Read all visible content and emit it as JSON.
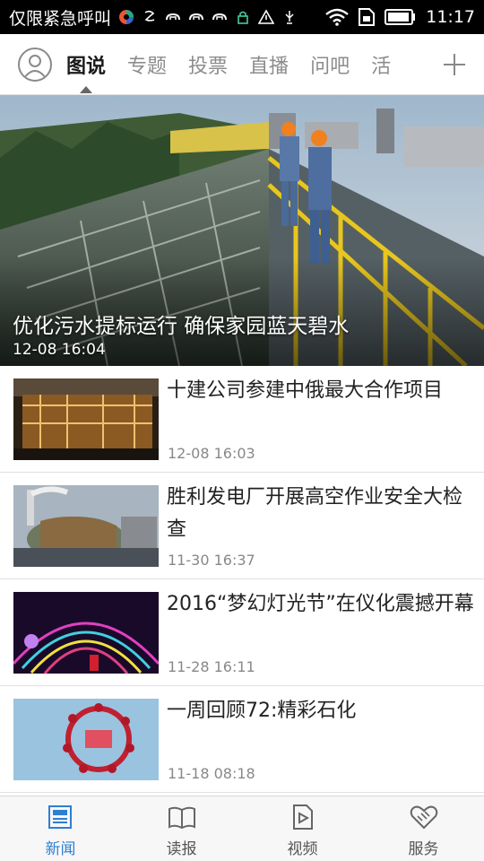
{
  "status_bar": {
    "carrier": "仅限紧急呼叫",
    "time": "11:17"
  },
  "top_nav": {
    "tabs": [
      {
        "label": "图说",
        "active": true
      },
      {
        "label": "专题",
        "active": false
      },
      {
        "label": "投票",
        "active": false
      },
      {
        "label": "直播",
        "active": false
      },
      {
        "label": "问吧",
        "active": false
      },
      {
        "label": "活",
        "active": false
      }
    ]
  },
  "hero": {
    "title": "优化污水提标运行 确保家园蓝天碧水",
    "time": "12-08 16:04"
  },
  "news": [
    {
      "title": "十建公司参建中俄最大合作项目",
      "time": "12-08 16:03"
    },
    {
      "title": "胜利发电厂开展高空作业安全大检查",
      "time": "11-30 16:37"
    },
    {
      "title": "2016“梦幻灯光节”在仪化震撼开幕",
      "time": "11-28 16:11"
    },
    {
      "title": "一周回顾72:精彩石化",
      "time": "11-18 08:18"
    }
  ],
  "bottom_nav": {
    "items": [
      {
        "label": "新闻",
        "active": true
      },
      {
        "label": "读报",
        "active": false
      },
      {
        "label": "视频",
        "active": false
      },
      {
        "label": "服务",
        "active": false
      }
    ],
    "active_color": "#2e7fd0"
  }
}
